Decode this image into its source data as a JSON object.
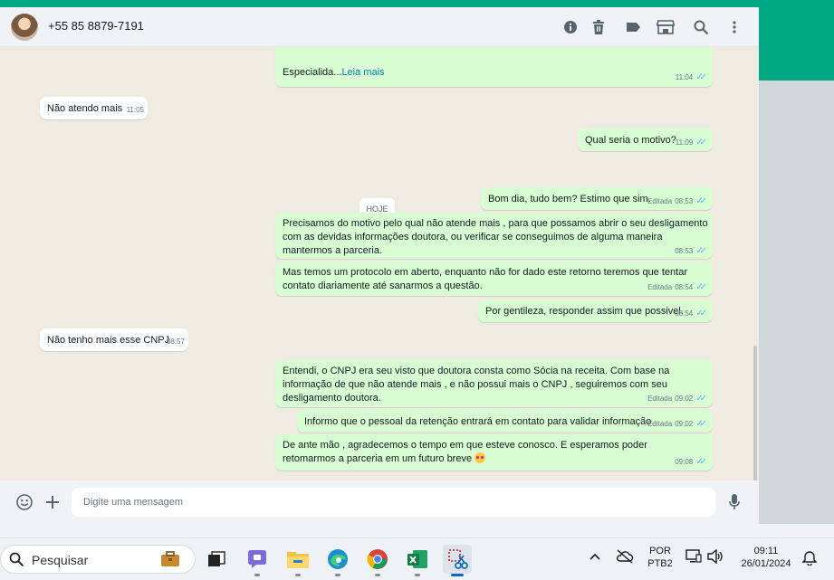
{
  "chat": {
    "contact_name": "+55 85 8879-7191",
    "day_divider": "HOJE",
    "messages": [
      {
        "dir": "out",
        "text": "Especialida...",
        "link": "Leia mais",
        "time": "11:04",
        "edited": ""
      },
      {
        "dir": "in",
        "text": "Não atendo mais",
        "time": "11:05"
      },
      {
        "dir": "out",
        "text": "Qual seria o motivo?",
        "time": "11:09",
        "edited": ""
      },
      {
        "dir": "out",
        "text": "Bom dia, tudo bem? Estimo que sim.",
        "time": "08:53",
        "edited": "Editada"
      },
      {
        "dir": "out",
        "text": "Precisamos do motivo pelo qual não atende mais , para que possamos abrir o seu desligamento com as devidas informações doutora, ou verificar se conseguimos de alguma maneira mantermos a parceria.",
        "time": "08:53",
        "edited": ""
      },
      {
        "dir": "out",
        "text": "Mas temos um protocolo em aberto, enquanto não for dado este retorno teremos que tentar contato diariamente até sanarmos a questão.",
        "time": "08:54",
        "edited": "Editada"
      },
      {
        "dir": "out",
        "text": "Por gentileza, responder assim que possivel.",
        "time": "08:54",
        "edited": ""
      },
      {
        "dir": "in",
        "text": "Não tenho mais esse CNPJ",
        "time": "08:57"
      },
      {
        "dir": "out",
        "text": "Entendi, o CNPJ era seu visto que doutora consta como Sócia na receita. Com base na informação de que não atende mais , e não possui mais o CNPJ , seguiremos com seu desligamento doutora.",
        "time": "09:02",
        "edited": "Editada"
      },
      {
        "dir": "out",
        "text": "Informo que o pessoal da retenção entrará em contato para validar informação.",
        "time": "09:02",
        "edited": "Editada"
      },
      {
        "dir": "out",
        "text": "De ante mão , agradecemos o tempo em que esteve conosco. E esperamos poder retomarmos a parceria em um futuro breve",
        "time": "09:08",
        "edited": ""
      }
    ],
    "composer_placeholder": "Digite uma mensagem"
  },
  "taskbar": {
    "search_label": "Pesquisar",
    "language": "POR",
    "keyboard": "PTB2",
    "time": "09:11",
    "date": "26/01/2024"
  },
  "icons": {
    "header": [
      "info-icon",
      "trash-icon",
      "label-icon",
      "store-icon",
      "search-icon",
      "menu-icon"
    ],
    "composer": [
      "emoji-icon",
      "plus-icon",
      "mic-icon"
    ]
  },
  "colors": {
    "accent": "#00a884",
    "outgoing_bubble": "#d9fdd3",
    "incoming_bubble": "#ffffff",
    "read_ticks": "#53bdeb",
    "link": "#027eb5"
  }
}
